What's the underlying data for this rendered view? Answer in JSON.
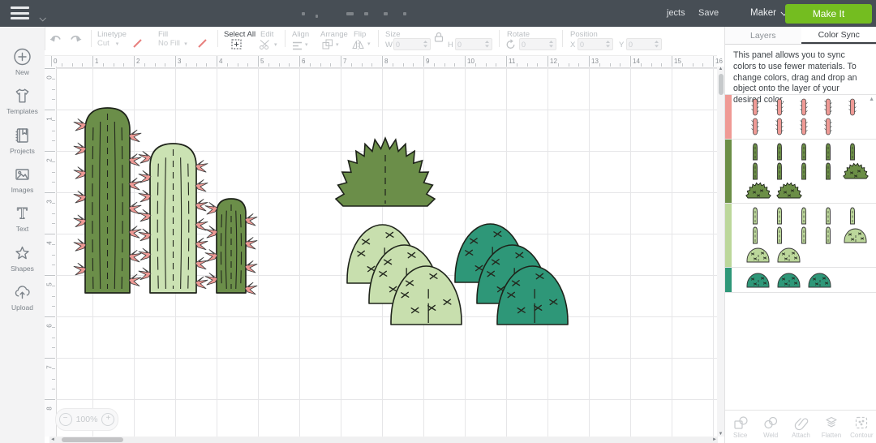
{
  "header": {
    "projects_label": "jects",
    "save_label": "Save",
    "machine_label": "Maker",
    "make_it_label": "Make It"
  },
  "toolbar": {
    "linetype_label": "Linetype",
    "linetype_value": "Cut",
    "fill_label": "Fill",
    "fill_value": "No Fill",
    "select_all_label": "Select All",
    "edit_label": "Edit",
    "align_label": "Align",
    "arrange_label": "Arrange",
    "flip_label": "Flip",
    "size_label": "Size",
    "w_label": "W",
    "w_value": "0",
    "h_label": "H",
    "h_value": "0",
    "rotate_label": "Rotate",
    "rotate_value": "0",
    "position_label": "Position",
    "x_label": "X",
    "x_value": "0",
    "y_label": "Y",
    "y_value": "0"
  },
  "sidebar": {
    "items": [
      {
        "icon": "plus-circle",
        "label": "New"
      },
      {
        "icon": "tshirt",
        "label": "Templates"
      },
      {
        "icon": "notebook",
        "label": "Projects"
      },
      {
        "icon": "photo",
        "label": "Images"
      },
      {
        "icon": "letter-t",
        "label": "Text"
      },
      {
        "icon": "shapes",
        "label": "Shapes"
      },
      {
        "icon": "cloud-upload",
        "label": "Upload"
      }
    ]
  },
  "canvas": {
    "h_ruler": [
      "0",
      "1",
      "2",
      "3",
      "4",
      "5",
      "6",
      "7",
      "8",
      "9",
      "10",
      "11",
      "12",
      "13",
      "14",
      "15",
      "16"
    ],
    "v_ruler": [
      "0",
      "1",
      "2",
      "3",
      "4",
      "5",
      "6",
      "7",
      "8"
    ],
    "zoom_minus": "−",
    "zoom_value": "100%",
    "zoom_plus": "+",
    "objects": [
      {
        "type": "tall-cactus",
        "fill": "#6B8E49",
        "spines": "#EF9A95"
      },
      {
        "type": "tall-cactus",
        "fill": "#CBE2B3",
        "spines": "#EF9A95"
      },
      {
        "type": "tall-cactus",
        "fill": "#6B8E49",
        "spines": "#EF9A95"
      },
      {
        "type": "spiky-bush",
        "fill": "#6B8E49"
      },
      {
        "type": "dome-group",
        "fill": "#C8DFAE",
        "count": 3
      },
      {
        "type": "dome-group",
        "fill": "#2E9778",
        "count": 3
      }
    ]
  },
  "panel": {
    "tabs": [
      {
        "label": "Layers",
        "active": false
      },
      {
        "label": "Color Sync",
        "active": true
      }
    ],
    "description": "This panel allows you to sync colors to use fewer materials. To change colors, drag and drop an object onto the layer of your desired color.",
    "rows": [
      {
        "name": "salmon",
        "color": "#EF9A95",
        "lines": [
          [
            "spine",
            "spine",
            "spine",
            "spine",
            "spine"
          ],
          [
            "spine",
            "spine",
            "spine",
            "spine"
          ]
        ]
      },
      {
        "name": "olive-green",
        "color": "#6B8E46",
        "lines": [
          [
            "sliver",
            "sliver",
            "sliver",
            "sliver",
            "sliver"
          ],
          [
            "sliver",
            "sliver",
            "sliver",
            "sliver",
            "bush"
          ],
          [
            "bush",
            "bush"
          ]
        ]
      },
      {
        "name": "light-green",
        "color": "#BCD79B",
        "lines": [
          [
            "sliver",
            "sliver",
            "sliver",
            "sliver",
            "sliver"
          ],
          [
            "sliver",
            "sliver",
            "sliver",
            "sliver",
            "dome"
          ],
          [
            "dome",
            "dome"
          ]
        ]
      },
      {
        "name": "teal",
        "color": "#2E9778",
        "lines": [
          [
            "dome",
            "dome",
            "dome"
          ]
        ]
      }
    ],
    "actions": [
      {
        "icon": "slice",
        "label": "Slice"
      },
      {
        "icon": "weld",
        "label": "Weld"
      },
      {
        "icon": "attach",
        "label": "Attach"
      },
      {
        "icon": "flatten",
        "label": "Flatten"
      },
      {
        "icon": "contour",
        "label": "Contour"
      }
    ]
  },
  "colors": {
    "header_bg": "#474E55",
    "accent_green": "#74BD20",
    "salmon": "#EF9A95",
    "olive": "#6B8E49",
    "light_green": "#C8DFAE",
    "teal": "#2E9778",
    "outline": "#1e231a",
    "red_swatch": "#E8807E"
  }
}
